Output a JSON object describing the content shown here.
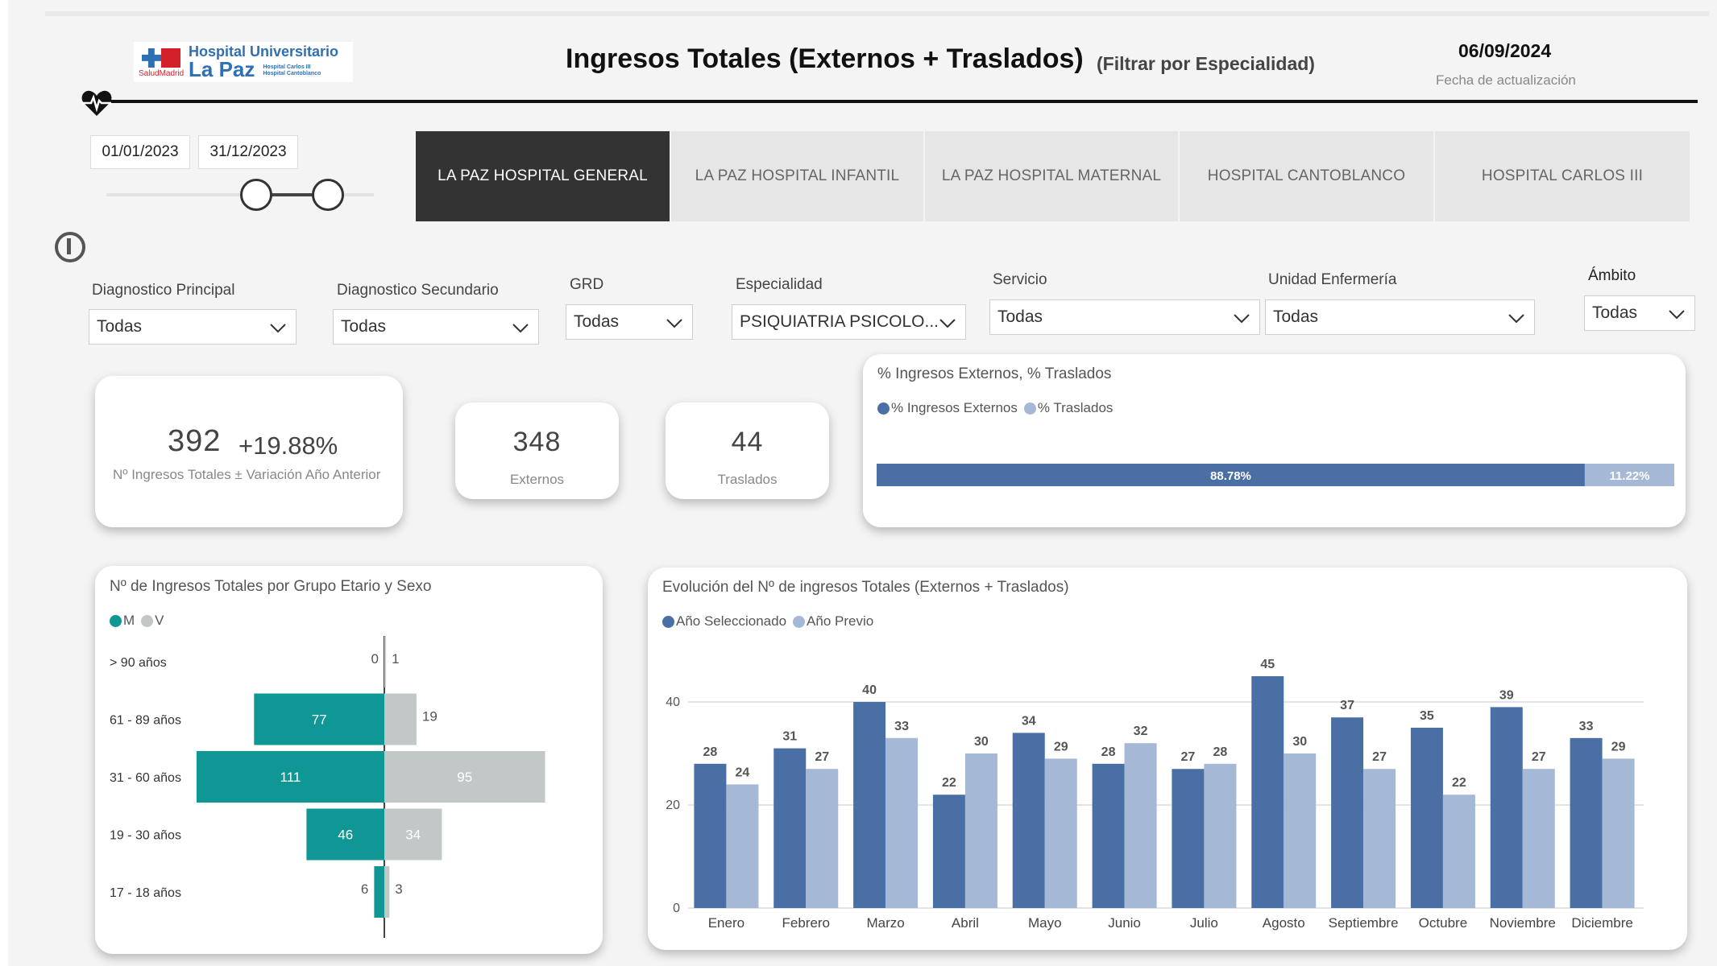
{
  "header": {
    "logo_text_1": "Hospital Universitario",
    "logo_text_2": "La Paz",
    "logo_small_1": "Hospital Carlos III",
    "logo_small_2": "Hospital Cantoblanco",
    "logo_sub": "SaludMadrid",
    "title": "Ingresos Totales (Externos + Traslados)",
    "subtitle": "(Filtrar por Especialidad)",
    "date": "06/09/2024",
    "date_label": "Fecha de actualización"
  },
  "date_range": {
    "start": "01/01/2023",
    "end": "31/12/2023"
  },
  "tabs": [
    {
      "label": "LA PAZ HOSPITAL GENERAL",
      "active": true
    },
    {
      "label": "LA PAZ HOSPITAL INFANTIL",
      "active": false
    },
    {
      "label": "LA PAZ HOSPITAL MATERNAL",
      "active": false
    },
    {
      "label": "HOSPITAL CANTOBLANCO",
      "active": false
    },
    {
      "label": "HOSPITAL CARLOS III",
      "active": false
    }
  ],
  "filters": {
    "diag_principal": {
      "label": "Diagnostico Principal",
      "value": "Todas"
    },
    "diag_secundario": {
      "label": "Diagnostico Secundario",
      "value": "Todas"
    },
    "grd": {
      "label": "GRD",
      "value": "Todas"
    },
    "especialidad": {
      "label": "Especialidad",
      "value": "PSIQUIATRIA PSICOLO..."
    },
    "servicio": {
      "label": "Servicio",
      "value": "Todas"
    },
    "unidad": {
      "label": "Unidad Enfermería",
      "value": "Todas"
    },
    "ambito": {
      "label": "Ámbito",
      "value": "Todas"
    }
  },
  "kpis": {
    "total": "392",
    "variation": "+19.88%",
    "total_label": "Nº Ingresos Totales ± Variación Año Anterior",
    "externos": "348",
    "externos_label": "Externos",
    "traslados": "44",
    "traslados_label": "Traslados"
  },
  "colors": {
    "blue_dark": "#4a6fa5",
    "blue_light": "#a5b8d6",
    "teal": "#0f9796",
    "grey": "#c2c8c7",
    "tab_active": "#333333"
  },
  "chart_data": [
    {
      "type": "bar",
      "orientation": "horizontal-stacked-100",
      "title": "% Ingresos Externos, % Traslados",
      "series": [
        {
          "name": "% Ingresos Externos",
          "values": [
            88.78
          ],
          "label": "88.78%"
        },
        {
          "name": "% Traslados",
          "values": [
            11.22
          ],
          "label": "11.22%"
        }
      ]
    },
    {
      "type": "bar",
      "orientation": "horizontal-butterfly",
      "title": "Nº de Ingresos Totales por Grupo Etario y Sexo",
      "categories": [
        "> 90 años",
        "61 - 89 años",
        "31 - 60 años",
        "19 - 30 años",
        "17 - 18 años"
      ],
      "series": [
        {
          "name": "M",
          "values": [
            0,
            77,
            111,
            46,
            6
          ]
        },
        {
          "name": "V",
          "values": [
            1,
            19,
            95,
            34,
            3
          ]
        }
      ]
    },
    {
      "type": "bar",
      "title": "Evolución del Nº de ingresos Totales (Externos + Traslados)",
      "categories": [
        "Enero",
        "Febrero",
        "Marzo",
        "Abril",
        "Mayo",
        "Junio",
        "Julio",
        "Agosto",
        "Septiembre",
        "Octubre",
        "Noviembre",
        "Diciembre"
      ],
      "series": [
        {
          "name": "Año Seleccionado",
          "values": [
            28,
            31,
            40,
            22,
            34,
            28,
            27,
            45,
            37,
            35,
            39,
            33
          ]
        },
        {
          "name": "Año Previo",
          "values": [
            24,
            27,
            33,
            30,
            29,
            32,
            28,
            30,
            27,
            22,
            27,
            29
          ]
        }
      ],
      "ylim": [
        0,
        45
      ],
      "yticks": [
        0,
        20,
        40
      ],
      "grid": true
    }
  ]
}
